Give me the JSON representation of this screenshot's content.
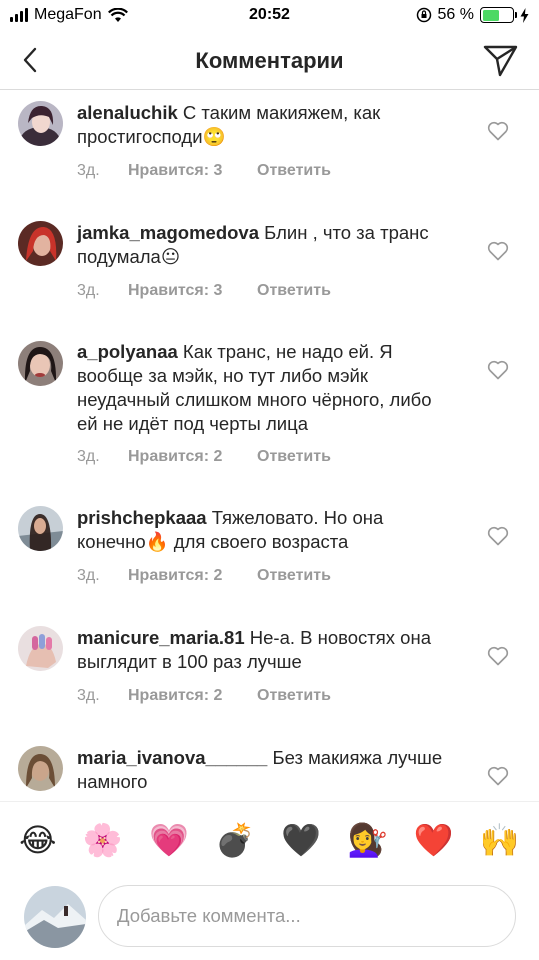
{
  "status_bar": {
    "carrier": "MegaFon",
    "time": "20:52",
    "battery": "56 %",
    "battery_level": 0.56
  },
  "header": {
    "title": "Комментарии",
    "back_icon": "chevron-left-icon",
    "send_icon": "paper-plane-icon"
  },
  "comments": [
    {
      "username": "alenaluchik",
      "text": "С таким макияжем, как простигосподи🙄",
      "time": "3д.",
      "likes": "Нравится: 3",
      "reply": "Ответить"
    },
    {
      "username": "jamka_magomedova",
      "text": "Блин , что за транс подумала😐",
      "time": "3д.",
      "likes": "Нравится: 3",
      "reply": "Ответить"
    },
    {
      "username": "a_polyanaa",
      "text": "Как транс, не надо ей. Я вообще за мэйк, но тут либо мэйк неудачный слишком много чёрного, либо ей не идёт под черты лица",
      "time": "3д.",
      "likes": "Нравится: 2",
      "reply": "Ответить"
    },
    {
      "username": "prishchepkaaa",
      "text": "Тяжеловато. Но она конечно🔥 для своего возраста",
      "time": "3д.",
      "likes": "Нравится: 2",
      "reply": "Ответить"
    },
    {
      "username": "manicure_maria.81",
      "text": "Не-а. В новостях она выглядит в 100 раз лучше",
      "time": "3д.",
      "likes": "Нравится: 2",
      "reply": "Ответить"
    },
    {
      "username": "maria_ivanova______",
      "text": "Без макияжа лучше намного",
      "time": "",
      "likes": "",
      "reply": ""
    }
  ],
  "emoji_bar": [
    "😂",
    "🌸",
    "💗",
    "💣",
    "🖤",
    "💇‍♀️",
    "❤️",
    "🙌"
  ],
  "composer": {
    "placeholder": "Добавьте коммента..."
  },
  "colors": {
    "text": "#262626",
    "meta": "#999999",
    "border": "#dbdbdb",
    "battery": "#4cd964"
  }
}
